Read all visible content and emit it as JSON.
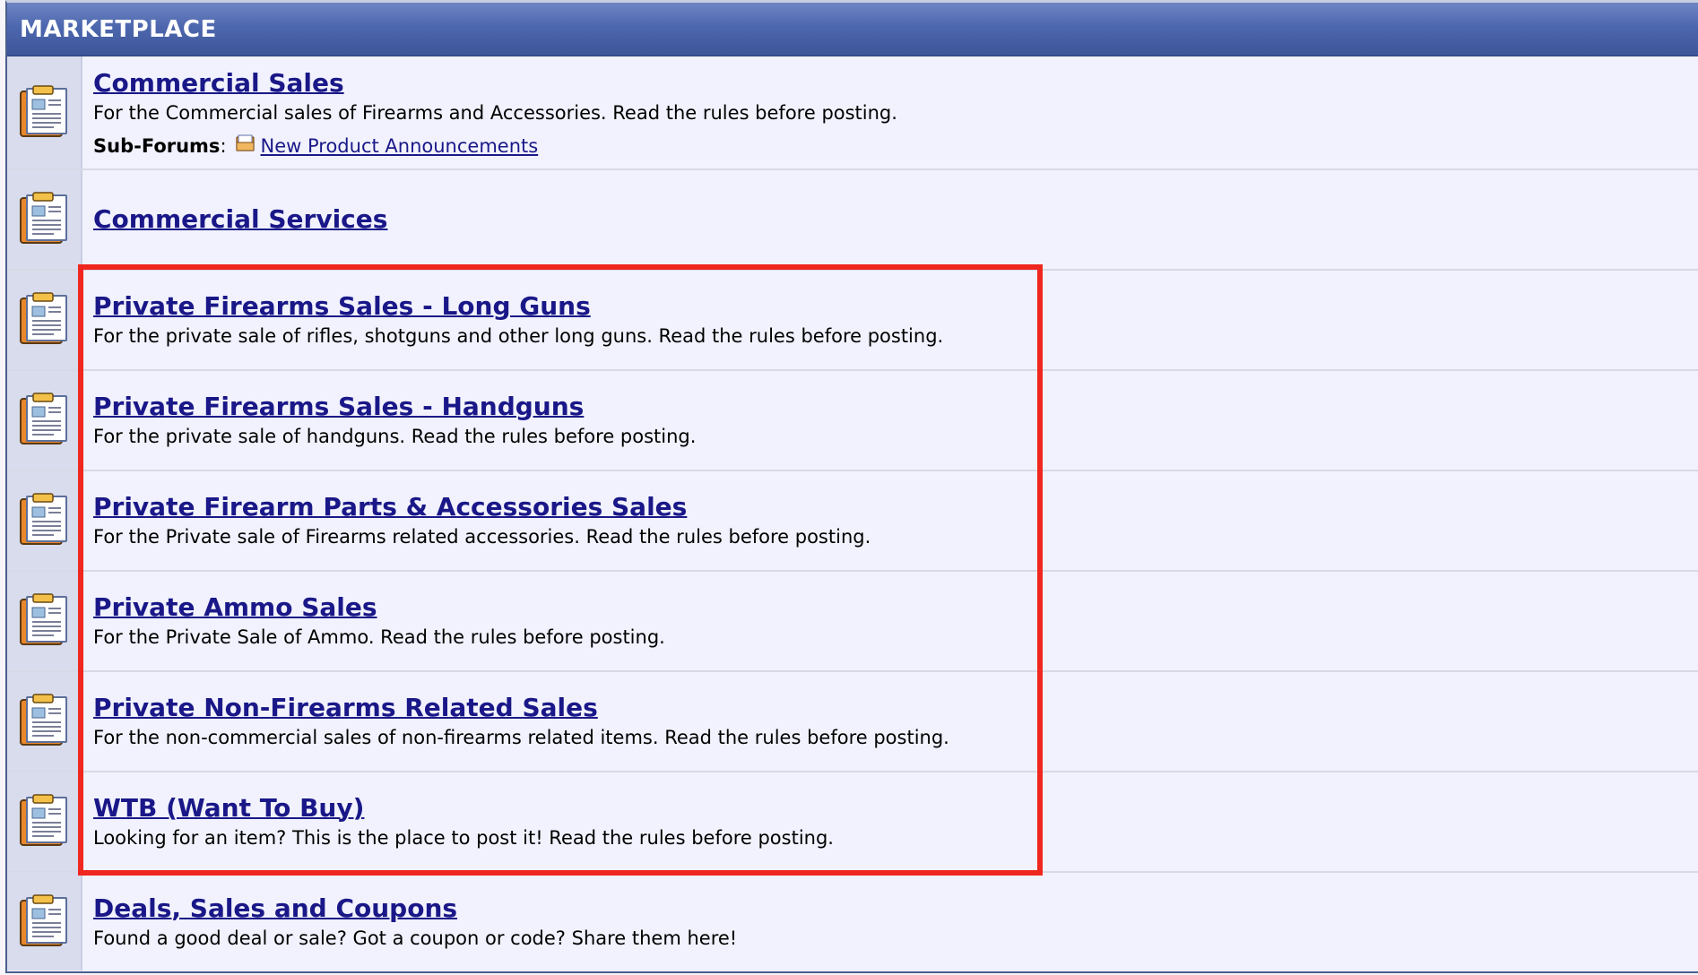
{
  "category": {
    "title": "MARKETPLACE"
  },
  "forums": [
    {
      "title": "Commercial Sales",
      "description": "For the Commercial sales of Firearms and Accessories. Read the rules before posting.",
      "subforums_label": "Sub-Forums",
      "subforums_separator": ":",
      "subforums": [
        "New Product Announcements"
      ]
    },
    {
      "title": "Commercial Services",
      "description": ""
    },
    {
      "title": "Private Firearms Sales - Long Guns",
      "description": "For the private sale of rifles, shotguns and other long guns. Read the rules before posting."
    },
    {
      "title": "Private Firearms Sales - Handguns",
      "description": "For the private sale of handguns. Read the rules before posting."
    },
    {
      "title": "Private Firearm Parts & Accessories Sales",
      "description": "For the Private sale of Firearms related accessories. Read the rules before posting."
    },
    {
      "title": "Private Ammo Sales",
      "description": "For the Private Sale of Ammo. Read the rules before posting."
    },
    {
      "title": "Private Non-Firearms Related Sales",
      "description": "For the non-commercial sales of non-firearms related items. Read the rules before posting."
    },
    {
      "title": "WTB (Want To Buy)",
      "description": "Looking for an item? This is the place to post it! Read the rules before posting."
    },
    {
      "title": "Deals, Sales and Coupons",
      "description": "Found a good deal or sale? Got a coupon or code? Share them here!"
    }
  ],
  "colors": {
    "header": "#4d67ae",
    "link": "#1a1888",
    "highlight": "#f0271f",
    "row_bg": "#f1f2fd",
    "icon_bg": "#d8dced"
  },
  "icons": {
    "forum": "forum-clipboard-icon",
    "subforum": "subforum-folder-icon"
  }
}
